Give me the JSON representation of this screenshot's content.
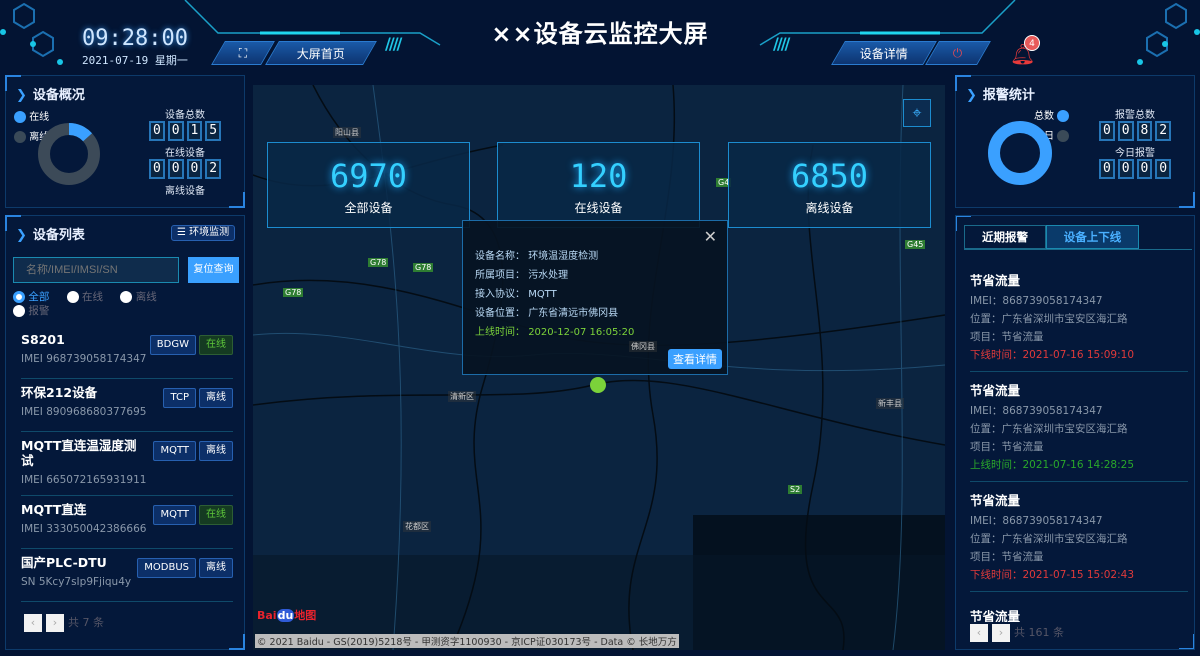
{
  "header": {
    "title": "××设备云监控大屏",
    "time": "09:28:00",
    "date": "2021-07-19 星期一",
    "home_label": "大屏首页",
    "detail_label": "设备详情",
    "alarm_count": "4"
  },
  "colors": {
    "accent": "#3aa0ff",
    "online": "#5ec63a",
    "offline_time": "#e03a3a",
    "online_time": "#2aa82a",
    "background": "#031433"
  },
  "overview": {
    "title": "设备概况",
    "legend": [
      "在线",
      "离线"
    ],
    "online_fraction": 0.133,
    "total_label": "设备总数",
    "total": [
      "0",
      "0",
      "1",
      "5"
    ],
    "online_label": "在线设备",
    "online": [
      "0",
      "0",
      "0",
      "2"
    ],
    "offline_label": "离线设备"
  },
  "device_list": {
    "title": "设备列表",
    "env_button": "环境监测",
    "search_placeholder": "名称/IMEI/IMSI/SN",
    "reset_button": "复位查询",
    "filters": [
      "全部",
      "在线",
      "离线",
      "报警"
    ],
    "items": [
      {
        "name": "S8201",
        "id": "IMEI 968739058174347",
        "protocol": "BDGW",
        "status": "在线"
      },
      {
        "name": "环保212设备",
        "id": "IMEI 890968680377695",
        "protocol": "TCP",
        "status": "离线"
      },
      {
        "name": "MQTT直连温湿度测试",
        "id": "IMEI 665072165931911",
        "protocol": "MQTT",
        "status": "离线"
      },
      {
        "name": "MQTT直连",
        "id": "IMEI 333050042386666",
        "protocol": "MQTT",
        "status": "在线"
      },
      {
        "name": "国产PLC-DTU",
        "id": "SN 5Kcy7sIp9Fjiqu4y",
        "protocol": "MODBUS",
        "status": "离线"
      }
    ],
    "total": "共 7 条"
  },
  "map": {
    "cards": [
      {
        "value": "6970",
        "label": "全部设备"
      },
      {
        "value": "120",
        "label": "在线设备"
      },
      {
        "value": "6850",
        "label": "离线设备"
      }
    ],
    "labels": [
      "阳山县",
      "清新区",
      "佛冈县",
      "新丰县",
      "花都区"
    ],
    "roads": [
      "G78",
      "G78",
      "G78",
      "G4",
      "G45",
      "S2"
    ],
    "popup": {
      "rows": [
        [
          "设备名称：",
          "环境温湿度检测"
        ],
        [
          "所属项目：",
          "污水处理"
        ],
        [
          "接入协议：",
          "MQTT"
        ],
        [
          "设备位置：",
          "广东省清远市佛冈县"
        ]
      ],
      "time_label": "上线时间：",
      "time": "2020-12-07 16:05:20",
      "button": "查看详情"
    },
    "copyright": "© 2021 Baidu - GS(2019)5218号 - 甲测资字1100930 - 京ICP证030173号 - Data © 长地万方",
    "logo": "Bai du 地图"
  },
  "alarm_stats": {
    "title": "报警统计",
    "legend": [
      "总数",
      "今日"
    ],
    "total_label": "报警总数",
    "total": [
      "0",
      "0",
      "8",
      "2"
    ],
    "today_label": "今日报警",
    "today": [
      "0",
      "0",
      "0",
      "0"
    ]
  },
  "events": {
    "tabs": [
      "近期报警",
      "设备上下线"
    ],
    "active_tab": 1,
    "items": [
      {
        "name": "节省流量",
        "imei": "IMEI：868739058174347",
        "loc": "位置：广东省深圳市宝安区海汇路",
        "proj": "项目：节省流量",
        "time": "下线时间：2021-07-16 15:09:10",
        "type": "offline"
      },
      {
        "name": "节省流量",
        "imei": "IMEI：868739058174347",
        "loc": "位置：广东省深圳市宝安区海汇路",
        "proj": "项目：节省流量",
        "time": "上线时间：2021-07-16 14:28:25",
        "type": "online"
      },
      {
        "name": "节省流量",
        "imei": "IMEI：868739058174347",
        "loc": "位置：广东省深圳市宝安区海汇路",
        "proj": "项目：节省流量",
        "time": "下线时间：2021-07-15 15:02:43",
        "type": "offline"
      }
    ],
    "partial": "节省流量",
    "total": "共 161 条"
  }
}
